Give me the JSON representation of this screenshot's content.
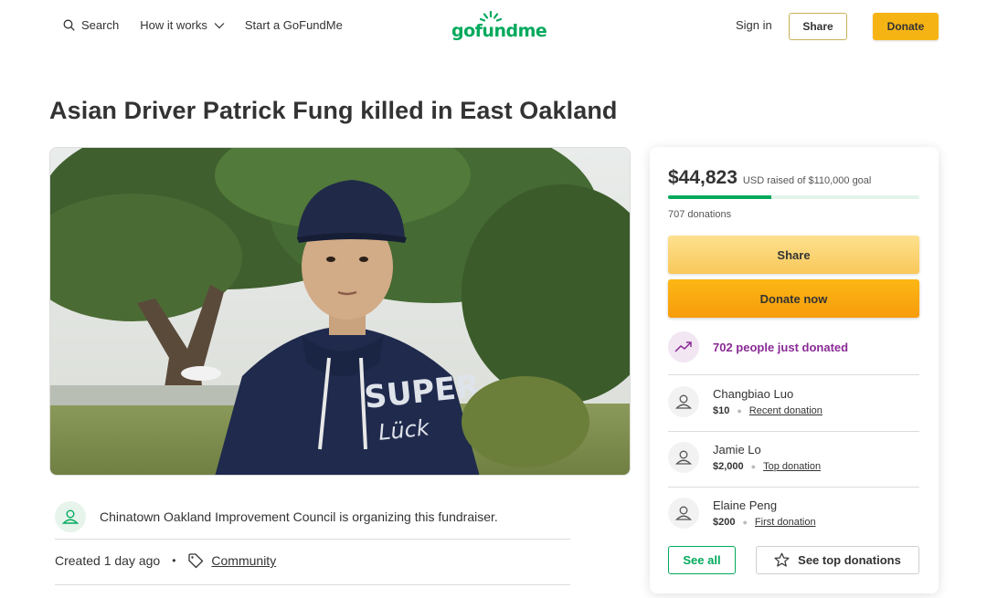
{
  "header": {
    "search_label": "Search",
    "how_it_works_label": "How it works",
    "start_label": "Start a GoFundMe",
    "logo_text": "gofundme",
    "signin_label": "Sign in",
    "share_label": "Share",
    "donate_label": "Donate"
  },
  "campaign": {
    "title": "Asian Driver Patrick Fung killed in East Oakland",
    "organizer_text": "Chinatown Oakland Improvement Council is organizing this fundraiser.",
    "created_text": "Created 1 day ago",
    "category": "Community"
  },
  "panel": {
    "raised_amount": "$44,823",
    "raised_sub": "USD raised of $110,000 goal",
    "progress_fraction": 0.41,
    "donation_count": "707 donations",
    "share_label": "Share",
    "donate_now_label": "Donate now",
    "just_donated": "702 people just donated",
    "donors": [
      {
        "name": "Changbiao Luo",
        "amount": "$10",
        "type": "Recent donation"
      },
      {
        "name": "Jamie Lo",
        "amount": "$2,000",
        "type": "Top donation"
      },
      {
        "name": "Elaine Peng",
        "amount": "$200",
        "type": "First donation"
      }
    ],
    "see_all_label": "See all",
    "see_top_label": "See top donations"
  },
  "colors": {
    "brand_green": "#02a95c",
    "donate_orange": "#f6b414",
    "purple": "#8a2b96"
  }
}
